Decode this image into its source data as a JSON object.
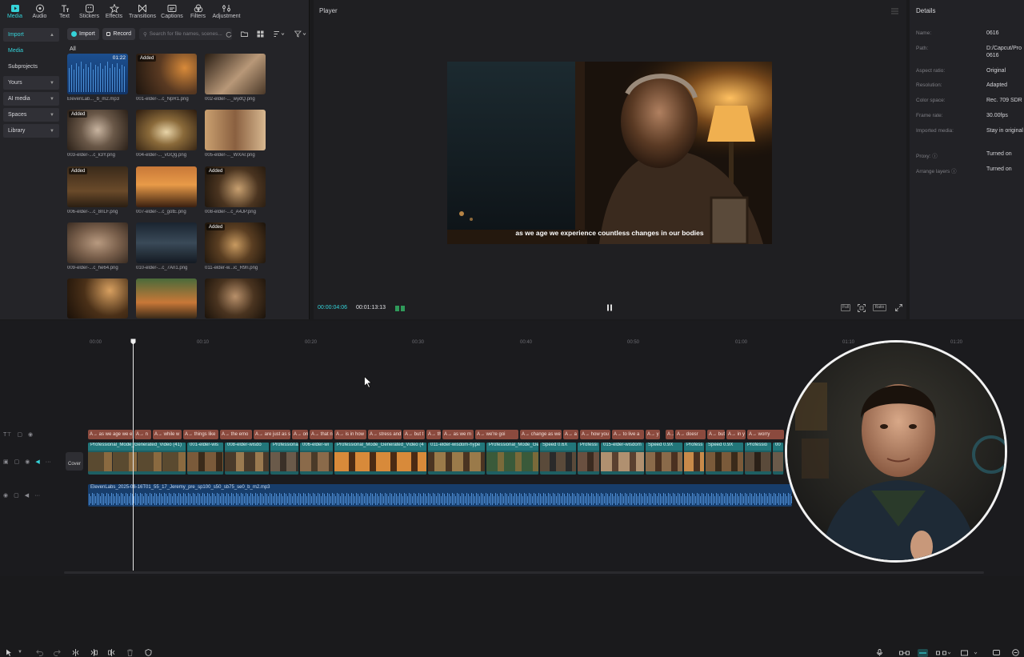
{
  "top_tabs": [
    {
      "label": "Media",
      "icon": "media-icon",
      "active": true
    },
    {
      "label": "Audio",
      "icon": "audio-icon"
    },
    {
      "label": "Text",
      "icon": "text-icon"
    },
    {
      "label": "Stickers",
      "icon": "stickers-icon"
    },
    {
      "label": "Effects",
      "icon": "effects-icon"
    },
    {
      "label": "Transitions",
      "icon": "transitions-icon"
    },
    {
      "label": "Captions",
      "icon": "captions-icon"
    },
    {
      "label": "Filters",
      "icon": "filters-icon"
    },
    {
      "label": "Adjustment",
      "icon": "adjustment-icon"
    }
  ],
  "left_nav": {
    "import": "Import",
    "media": "Media",
    "subprojects": "Subprojects",
    "yours": "Yours",
    "ai_media": "AI media",
    "spaces": "Spaces",
    "library": "Library"
  },
  "media_toolbar": {
    "import_btn": "Import",
    "record_btn": "Record",
    "search_placeholder": "Search for file names, scenes..."
  },
  "all_label": "All",
  "media_items": [
    {
      "name": "ElevenLab..._b_m2.mp3",
      "duration": "01:22",
      "added": ""
    },
    {
      "name": "001-elder-...c_NpR1.png",
      "duration": "",
      "added": "Added"
    },
    {
      "name": "002-elder-..._wydQ.png",
      "duration": "",
      "added": ""
    },
    {
      "name": "003-elder-...c_k3Y.png",
      "duration": "",
      "added": "Added"
    },
    {
      "name": "004-elder-..._vGQg.png",
      "duration": "",
      "added": ""
    },
    {
      "name": "005-elder-..._WXAr.png",
      "duration": "",
      "added": ""
    },
    {
      "name": "006-elder-...c_8nLF.png",
      "duration": "",
      "added": "Added"
    },
    {
      "name": "007-elder-...c_gotE.png",
      "duration": "",
      "added": ""
    },
    {
      "name": "008-elder-...c_A4JP.png",
      "duration": "",
      "added": "Added"
    },
    {
      "name": "009-elder-...c_he64.png",
      "duration": "",
      "added": ""
    },
    {
      "name": "010-elder-...c_7An1.png",
      "duration": "",
      "added": ""
    },
    {
      "name": "011-elder-w...ic_R9ri.png",
      "duration": "",
      "added": "Added"
    },
    {
      "name": "",
      "duration": "",
      "added": ""
    },
    {
      "name": "",
      "duration": "",
      "added": ""
    },
    {
      "name": "",
      "duration": "",
      "added": ""
    }
  ],
  "player": {
    "title": "Player",
    "subtitle": "as we age we experience countless changes in our bodies",
    "current_time": "00:00:04:06",
    "total_time": "00:01:13:13",
    "full_btn": "Full",
    "ratio_btn": "Ratio"
  },
  "details": {
    "title": "Details",
    "rows": [
      {
        "label": "Name:",
        "value": "0616"
      },
      {
        "label": "Path:",
        "value": "D:/Capcut/Pro"
      },
      {
        "label": "",
        "value": "0616"
      },
      {
        "label": "Aspect ratio:",
        "value": "Original"
      },
      {
        "label": "Resolution:",
        "value": "Adapted"
      },
      {
        "label": "Color space:",
        "value": "Rec. 709 SDR"
      },
      {
        "label": "Frame rate:",
        "value": "30.00fps"
      },
      {
        "label": "Imported media:",
        "value": "Stay in original"
      },
      {
        "label": "Proxy: ⓘ",
        "value": "Turned on"
      },
      {
        "label": "Arrange layers ⓘ",
        "value": "Turned on"
      }
    ]
  },
  "ruler_ticks": [
    "00:00",
    "00:10",
    "00:20",
    "00:30",
    "00:40",
    "00:50",
    "01:00",
    "01:10",
    "01:20"
  ],
  "text_clips": [
    "A→ as we age we e",
    "A→ n",
    "A→ while w",
    "A→ things like",
    "A→ the emo",
    "A→ are just as si",
    "A→ on",
    "A→ that n",
    "A→ is in how",
    "A→ stress and",
    "A→ but t",
    "A→ th",
    "A→ as we m",
    "A→ we're goi",
    "A→ change as we",
    "A→ a",
    "A→ how you",
    "A→ to live a",
    "A→ y",
    "A→ i",
    "A→ doesr",
    "A→ but",
    "A→ in y",
    "A→ worry"
  ],
  "video_clips": [
    "Professional_Mode_Generated_Video (41)",
    "001-elder-wis",
    "008-elder-wisdo",
    "Professional",
    "006-elder-wi",
    "Professional_Mode_Generated_Video (4",
    "011-elder-wisdom-hype",
    "Professional_Mode_Ge",
    "Speed 0.6X",
    "Professi",
    "015-elder-wisdom",
    "Speed 0.9X",
    "Profess",
    "Speed 0.9X",
    "Professio",
    "00"
  ],
  "cover_label": "Cover",
  "audio_clip": "ElevenLabs_2025-06-16T01_55_17_Jeremy_pre_sp100_s50_sb75_se0_b_m2.mp3",
  "colors": {
    "accent": "#35d3d9",
    "text_clip": "#8b4a3e",
    "video_clip": "#1e5f63",
    "audio_clip": "#173d6b"
  }
}
